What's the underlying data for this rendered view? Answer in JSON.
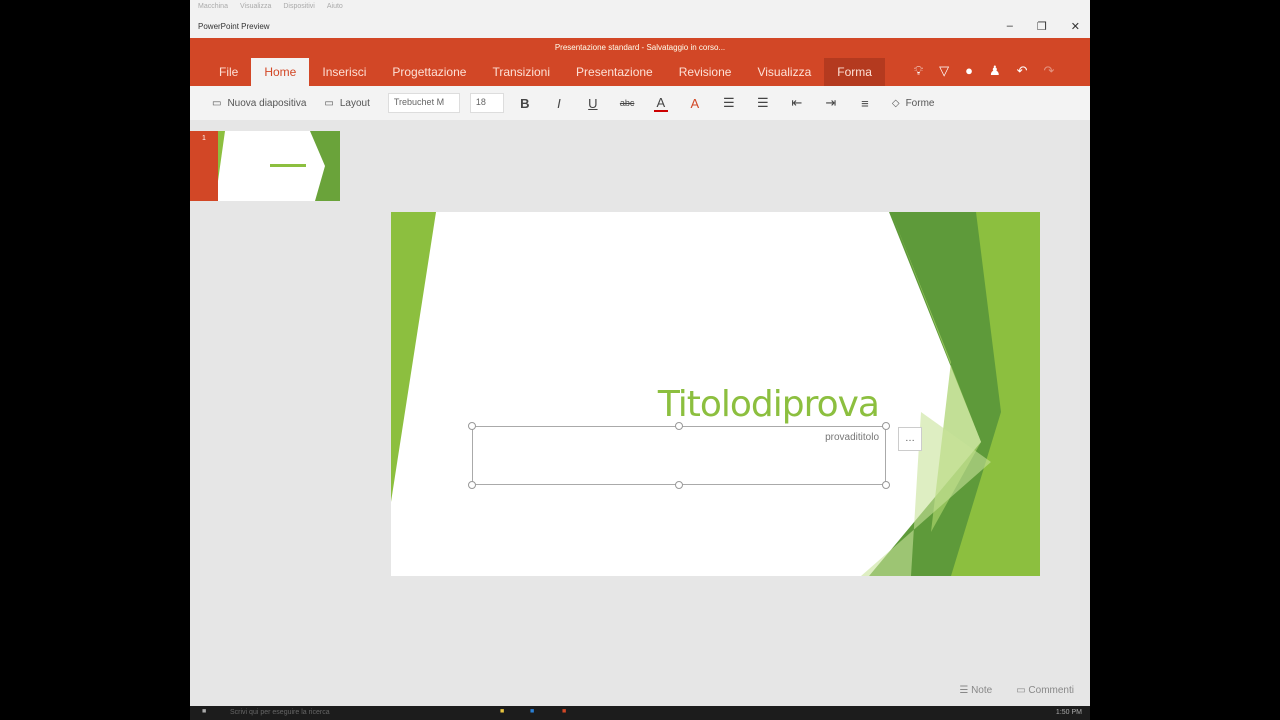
{
  "system_menu": [
    "Macchina",
    "Visualizza",
    "Dispositivi",
    "Aiuto"
  ],
  "app_title": "PowerPoint Preview",
  "window_buttons": {
    "minimize": "–",
    "maximize": "❐",
    "close": "✕"
  },
  "document_title": "Presentazione standard - Salvataggio in corso...",
  "tabs": [
    "File",
    "Home",
    "Inserisci",
    "Progettazione",
    "Transizioni",
    "Presentazione",
    "Revisione",
    "Visualizza",
    "Forma"
  ],
  "toolbar": {
    "new_slide": "Nuova diapositiva",
    "layout": "Layout",
    "font": "Trebuchet M",
    "size": "18",
    "bold": "B",
    "italic": "I",
    "underline": "U",
    "strike": "abc",
    "font_color": "A",
    "clear": "A",
    "shapes": "Forme"
  },
  "thumbnail": {
    "number": "1"
  },
  "slide": {
    "title": "Titolodiprova",
    "subtitle": "provadititolo",
    "more": "…"
  },
  "status": {
    "notes": "Note",
    "comments": "Commenti"
  },
  "taskbar": {
    "search": "Scrivi qui per eseguire la ricerca",
    "time": "1:50 PM"
  },
  "colors": {
    "accent": "#d24726",
    "slide_green": "#8cbf3f"
  }
}
